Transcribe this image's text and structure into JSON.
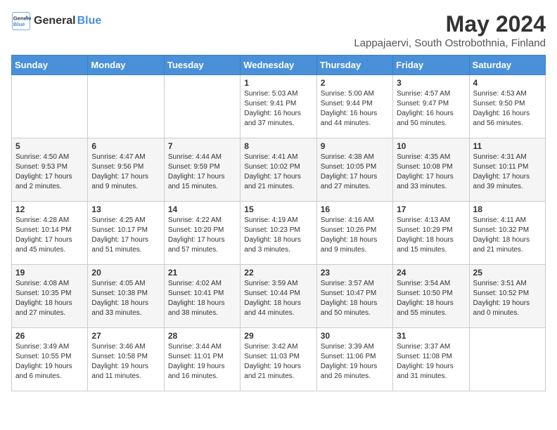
{
  "header": {
    "logo_line1": "General",
    "logo_line2": "Blue",
    "title": "May 2024",
    "subtitle": "Lappajaervi, South Ostrobothnia, Finland"
  },
  "days_of_week": [
    "Sunday",
    "Monday",
    "Tuesday",
    "Wednesday",
    "Thursday",
    "Friday",
    "Saturday"
  ],
  "weeks": [
    [
      {
        "day": "",
        "info": ""
      },
      {
        "day": "",
        "info": ""
      },
      {
        "day": "",
        "info": ""
      },
      {
        "day": "1",
        "info": "Sunrise: 5:03 AM\nSunset: 9:41 PM\nDaylight: 16 hours and 37 minutes."
      },
      {
        "day": "2",
        "info": "Sunrise: 5:00 AM\nSunset: 9:44 PM\nDaylight: 16 hours and 44 minutes."
      },
      {
        "day": "3",
        "info": "Sunrise: 4:57 AM\nSunset: 9:47 PM\nDaylight: 16 hours and 50 minutes."
      },
      {
        "day": "4",
        "info": "Sunrise: 4:53 AM\nSunset: 9:50 PM\nDaylight: 16 hours and 56 minutes."
      }
    ],
    [
      {
        "day": "5",
        "info": "Sunrise: 4:50 AM\nSunset: 9:53 PM\nDaylight: 17 hours and 2 minutes."
      },
      {
        "day": "6",
        "info": "Sunrise: 4:47 AM\nSunset: 9:56 PM\nDaylight: 17 hours and 9 minutes."
      },
      {
        "day": "7",
        "info": "Sunrise: 4:44 AM\nSunset: 9:59 PM\nDaylight: 17 hours and 15 minutes."
      },
      {
        "day": "8",
        "info": "Sunrise: 4:41 AM\nSunset: 10:02 PM\nDaylight: 17 hours and 21 minutes."
      },
      {
        "day": "9",
        "info": "Sunrise: 4:38 AM\nSunset: 10:05 PM\nDaylight: 17 hours and 27 minutes."
      },
      {
        "day": "10",
        "info": "Sunrise: 4:35 AM\nSunset: 10:08 PM\nDaylight: 17 hours and 33 minutes."
      },
      {
        "day": "11",
        "info": "Sunrise: 4:31 AM\nSunset: 10:11 PM\nDaylight: 17 hours and 39 minutes."
      }
    ],
    [
      {
        "day": "12",
        "info": "Sunrise: 4:28 AM\nSunset: 10:14 PM\nDaylight: 17 hours and 45 minutes."
      },
      {
        "day": "13",
        "info": "Sunrise: 4:25 AM\nSunset: 10:17 PM\nDaylight: 17 hours and 51 minutes."
      },
      {
        "day": "14",
        "info": "Sunrise: 4:22 AM\nSunset: 10:20 PM\nDaylight: 17 hours and 57 minutes."
      },
      {
        "day": "15",
        "info": "Sunrise: 4:19 AM\nSunset: 10:23 PM\nDaylight: 18 hours and 3 minutes."
      },
      {
        "day": "16",
        "info": "Sunrise: 4:16 AM\nSunset: 10:26 PM\nDaylight: 18 hours and 9 minutes."
      },
      {
        "day": "17",
        "info": "Sunrise: 4:13 AM\nSunset: 10:29 PM\nDaylight: 18 hours and 15 minutes."
      },
      {
        "day": "18",
        "info": "Sunrise: 4:11 AM\nSunset: 10:32 PM\nDaylight: 18 hours and 21 minutes."
      }
    ],
    [
      {
        "day": "19",
        "info": "Sunrise: 4:08 AM\nSunset: 10:35 PM\nDaylight: 18 hours and 27 minutes."
      },
      {
        "day": "20",
        "info": "Sunrise: 4:05 AM\nSunset: 10:38 PM\nDaylight: 18 hours and 33 minutes."
      },
      {
        "day": "21",
        "info": "Sunrise: 4:02 AM\nSunset: 10:41 PM\nDaylight: 18 hours and 38 minutes."
      },
      {
        "day": "22",
        "info": "Sunrise: 3:59 AM\nSunset: 10:44 PM\nDaylight: 18 hours and 44 minutes."
      },
      {
        "day": "23",
        "info": "Sunrise: 3:57 AM\nSunset: 10:47 PM\nDaylight: 18 hours and 50 minutes."
      },
      {
        "day": "24",
        "info": "Sunrise: 3:54 AM\nSunset: 10:50 PM\nDaylight: 18 hours and 55 minutes."
      },
      {
        "day": "25",
        "info": "Sunrise: 3:51 AM\nSunset: 10:52 PM\nDaylight: 19 hours and 0 minutes."
      }
    ],
    [
      {
        "day": "26",
        "info": "Sunrise: 3:49 AM\nSunset: 10:55 PM\nDaylight: 19 hours and 6 minutes."
      },
      {
        "day": "27",
        "info": "Sunrise: 3:46 AM\nSunset: 10:58 PM\nDaylight: 19 hours and 11 minutes."
      },
      {
        "day": "28",
        "info": "Sunrise: 3:44 AM\nSunset: 11:01 PM\nDaylight: 19 hours and 16 minutes."
      },
      {
        "day": "29",
        "info": "Sunrise: 3:42 AM\nSunset: 11:03 PM\nDaylight: 19 hours and 21 minutes."
      },
      {
        "day": "30",
        "info": "Sunrise: 3:39 AM\nSunset: 11:06 PM\nDaylight: 19 hours and 26 minutes."
      },
      {
        "day": "31",
        "info": "Sunrise: 3:37 AM\nSunset: 11:08 PM\nDaylight: 19 hours and 31 minutes."
      },
      {
        "day": "",
        "info": ""
      }
    ]
  ]
}
